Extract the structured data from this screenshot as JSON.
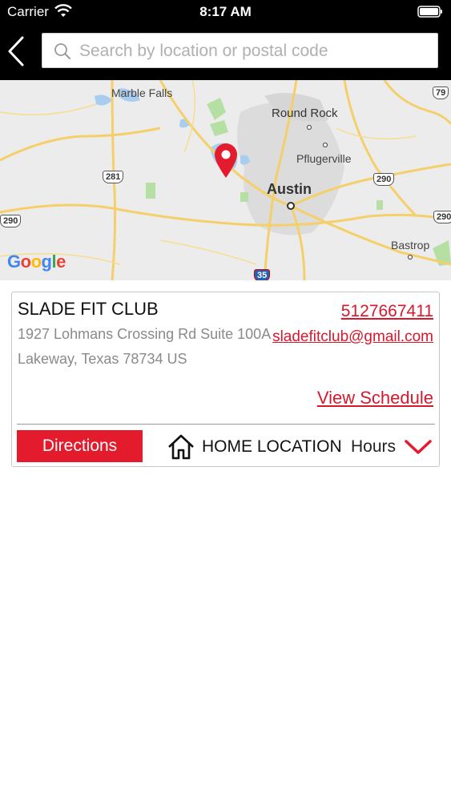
{
  "status_bar": {
    "carrier": "Carrier",
    "time": "8:17 AM"
  },
  "search": {
    "placeholder": "Search by location or postal code",
    "value": ""
  },
  "map": {
    "labels": {
      "marble_falls": "Marble Falls",
      "round_rock": "Round Rock",
      "pflugerville": "Pflugerville",
      "austin": "Austin",
      "bastrop": "Bastrop"
    },
    "shields": {
      "us281": "281",
      "us290_left": "290",
      "us290_right": "290",
      "tx79": "79",
      "i35": "35"
    },
    "google_logo": {
      "letters": [
        "G",
        "o",
        "o",
        "g",
        "l",
        "e"
      ],
      "colors": [
        "#4285F4",
        "#EA4335",
        "#FBBC05",
        "#4285F4",
        "#34A853",
        "#EA4335"
      ]
    },
    "pin_color": "#e31b2c"
  },
  "location": {
    "name": "SLADE FIT CLUB",
    "address_line1": "1927 Lohmans Crossing Rd Suite 100A",
    "address_line2": "Lakeway, Texas 78734 US",
    "phone": "5127667411",
    "email": "sladefitclub@gmail.com",
    "schedule_label": "View Schedule",
    "directions_label": "Directions",
    "home_label": "HOME LOCATION",
    "hours_label": "Hours"
  },
  "colors": {
    "accent": "#e31b2c",
    "header_bg": "#000000"
  }
}
